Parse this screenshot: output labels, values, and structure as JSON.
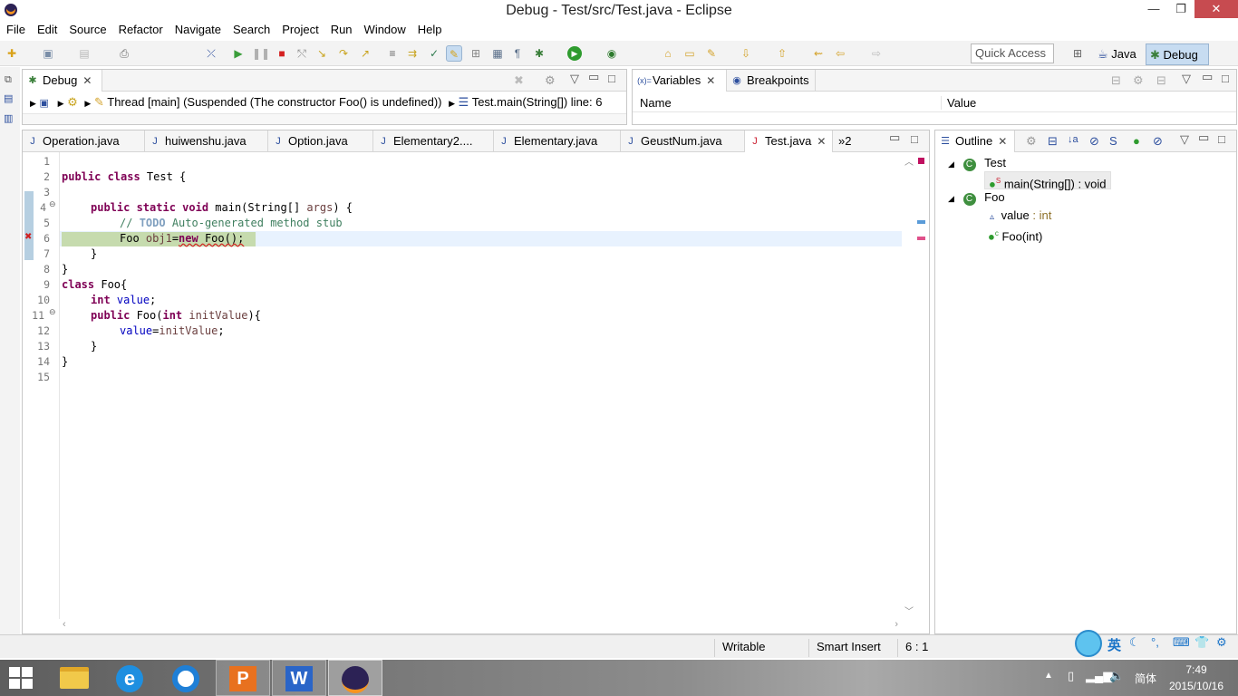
{
  "window": {
    "title": "Debug - Test/src/Test.java - Eclipse",
    "min": "—",
    "max": "❐",
    "close": "✕"
  },
  "menu": [
    "File",
    "Edit",
    "Source",
    "Refactor",
    "Navigate",
    "Search",
    "Project",
    "Run",
    "Window",
    "Help"
  ],
  "toolbar": {
    "quick_access_placeholder": "Quick Access",
    "perspectives": {
      "java": "Java",
      "debug": "Debug"
    }
  },
  "debug_view": {
    "tab": "Debug",
    "thread": "Thread [main] (Suspended (The constructor Foo() is undefined))",
    "frame": "Test.main(String[]) line: 6"
  },
  "variables_view": {
    "tabs": [
      "Variables",
      "Breakpoints"
    ],
    "columns": [
      "Name",
      "Value"
    ]
  },
  "editor": {
    "tabs": [
      "Operation.java",
      "huiwenshu.java",
      "Option.java",
      "Elementary2....",
      "Elementary.java",
      "GeustNum.java",
      "Test.java"
    ],
    "active_tab": "Test.java",
    "overflow": "»2",
    "line_numbers": [
      "1",
      "2",
      "3",
      "4",
      "5",
      "6",
      "7",
      "8",
      "9",
      "10",
      "11",
      "12",
      "13",
      "14",
      "15"
    ],
    "code": {
      "l2_kw": "public class",
      "l2_rest": " Test {",
      "l4_kw": "public static void",
      "l4_rest": " main(String[] ",
      "l4_var": "args",
      "l4_end": ") {",
      "l5_comment": "// ",
      "l5_todo": "TODO",
      "l5_rest": " Auto-generated method stub",
      "l6_a": "Foo ",
      "l6_var": "obj1",
      "l6_eq": "=",
      "l6_kw": "new",
      "l6_rest": " Foo();",
      "l7": "}",
      "l8": "}",
      "l9_kw": "class",
      "l9_rest": " Foo{",
      "l10_kw": "int",
      "l10_field": "value",
      "l10_end": ";",
      "l11_kw": "public",
      "l11_rest": " Foo(",
      "l11_kw2": "int",
      "l11_var": "initValue",
      "l11_end": "){",
      "l12_field": "value",
      "l12_eq": "=",
      "l12_var": "initValue",
      "l12_end": ";",
      "l13": "}",
      "l14": "}"
    }
  },
  "outline": {
    "tab": "Outline",
    "items": [
      {
        "label": "Test"
      },
      {
        "label": "main(String[]) : void",
        "superscript": "S"
      },
      {
        "label": "Foo"
      },
      {
        "label": "value",
        "type": " : int"
      },
      {
        "label": "Foo(int)",
        "superscript": "c"
      }
    ]
  },
  "status": {
    "writable": "Writable",
    "insert_mode": "Smart Insert",
    "position": "6 : 1"
  },
  "ime": {
    "lang": "英"
  },
  "taskbar": {
    "time": "7:49",
    "date": "2015/10/16",
    "lang": "简体"
  },
  "colors": {
    "keyword": "#7f0055",
    "comment": "#3f7f5f",
    "field": "#0000c0",
    "selected_persp": "#c7dcf1"
  }
}
